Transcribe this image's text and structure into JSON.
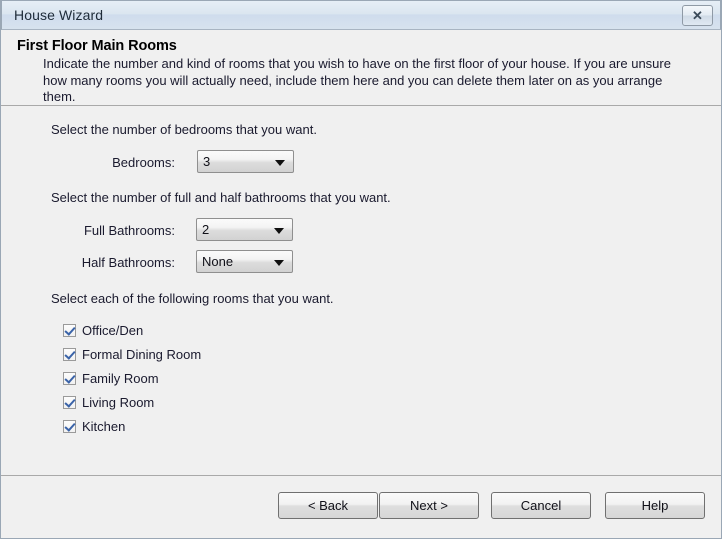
{
  "window": {
    "title": "House Wizard",
    "close_icon": "close-icon",
    "close_glyph": "✕"
  },
  "header": {
    "title": "First Floor Main Rooms",
    "description": "Indicate the number and kind of rooms that you wish to have on the first floor of your house. If you are unsure how many rooms you will actually need, include them here and you can delete them later on as you arrange them."
  },
  "body": {
    "bedrooms_prompt": "Select the number of bedrooms that you want.",
    "bedrooms_label": "Bedrooms:",
    "bedrooms_value": "3",
    "bathrooms_prompt": "Select the number of full and half bathrooms that you want.",
    "full_bathrooms_label": "Full Bathrooms:",
    "full_bathrooms_value": "2",
    "half_bathrooms_label": "Half Bathrooms:",
    "half_bathrooms_value": "None",
    "rooms_prompt": "Select each of the following rooms that you want.",
    "rooms": [
      {
        "label": "Office/Den",
        "checked": true
      },
      {
        "label": "Formal Dining Room",
        "checked": true
      },
      {
        "label": "Family Room",
        "checked": true
      },
      {
        "label": "Living Room",
        "checked": true
      },
      {
        "label": "Kitchen",
        "checked": true
      }
    ]
  },
  "footer": {
    "back_label": "< Back",
    "next_label": "Next >",
    "cancel_label": "Cancel",
    "help_label": "Help"
  },
  "colors": {
    "window_bg": "#f0f0f0",
    "titlebar_start": "#e6eef6",
    "titlebar_end": "#d7e2ee",
    "border": "#9aa7b5",
    "divider": "#a9a9a9",
    "text": "#1a1a2e",
    "checkmark": "#3a63a8"
  }
}
